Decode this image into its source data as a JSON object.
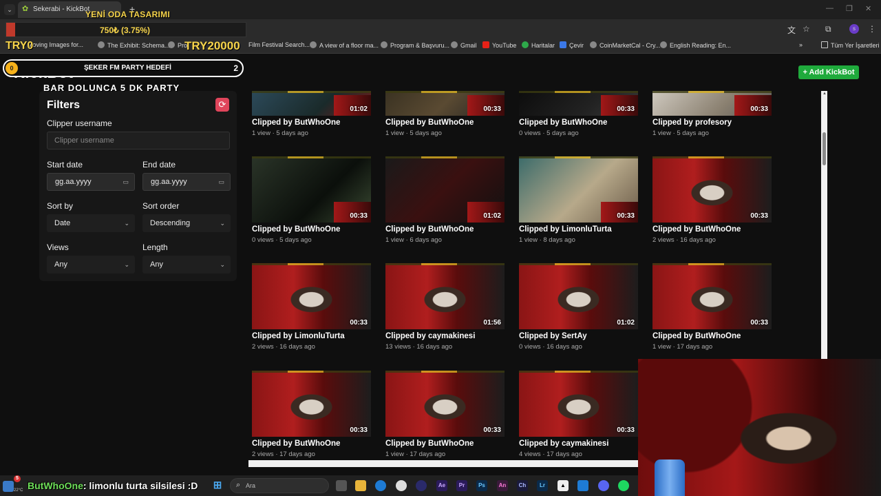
{
  "browser": {
    "tab_title": "Sekerabi - KickBot",
    "tab_new": "+",
    "tab_arrow": "⌄",
    "window_controls": [
      "—",
      "❐",
      "✕"
    ],
    "toolbar_icons": [
      "translate-icon",
      "star-icon",
      "extensions-icon",
      "profile-icon",
      "menu-icon"
    ],
    "profile_letter": "s",
    "bookmarks": [
      "Moving Images for...",
      "The Exhibit: Schema...",
      "Pro",
      "Film Festival Search...",
      "A view of a floor ma...",
      "Program & Başvuru...",
      "Gmail",
      "YouTube",
      "Haritalar",
      "Çevir",
      "CoinMarketCal - Cry...",
      "English Reading: En..."
    ],
    "bookmarks_more": "»",
    "bookmarks_all": "Tüm Yer İşaretleri"
  },
  "overlay": {
    "title": "YENİ ODA TASARIMI",
    "progress_text": "750₺ (3.75%)",
    "progress_percent": 3.75,
    "goal_min": "TRY0",
    "goal_max": "TRY20000",
    "party_label": "ŞEKER FM PARTY HEDEFİ",
    "party_count": "2",
    "coin": "0",
    "bar_text": "BAR DOLUNCA 5 DK PARTY",
    "chat_user": "ButWhoOne",
    "chat_text": ": limonlu turta silsilesi :D",
    "accent": "#f6d44b"
  },
  "app": {
    "logo": "KickBot",
    "add_button": "+ Add KickBot",
    "accent": "#1faa3c"
  },
  "filters": {
    "title": "Filters",
    "reset_icon": "refresh-icon",
    "clipper_label": "Clipper username",
    "clipper_placeholder": "Clipper username",
    "start_label": "Start date",
    "start_value": "gg.aa.yyyy",
    "end_label": "End date",
    "end_value": "gg.aa.yyyy",
    "sort_by_label": "Sort by",
    "sort_by_value": "Date",
    "sort_order_label": "Sort order",
    "sort_order_value": "Descending",
    "views_label": "Views",
    "views_value": "Any",
    "length_label": "Length",
    "length_value": "Any"
  },
  "clips": [
    {
      "by": "Clipped by ButWhoOne",
      "meta": "1 view · 5 days ago",
      "duration": "01:02",
      "thumb": "game1"
    },
    {
      "by": "Clipped by ButWhoOne",
      "meta": "1 view · 5 days ago",
      "duration": "00:33",
      "thumb": "game2"
    },
    {
      "by": "Clipped by ButWhoOne",
      "meta": "0 views · 5 days ago",
      "duration": "00:33",
      "thumb": "game3"
    },
    {
      "by": "Clipped by profesory",
      "meta": "1 view · 5 days ago",
      "duration": "00:33",
      "thumb": "game4"
    },
    {
      "by": "Clipped by ButWhoOne",
      "meta": "0 views · 5 days ago",
      "duration": "00:33",
      "thumb": "dark1"
    },
    {
      "by": "Clipped by ButWhoOne",
      "meta": "1 view · 6 days ago",
      "duration": "01:02",
      "thumb": "dark2"
    },
    {
      "by": "Clipped by LimonluTurta",
      "meta": "1 view · 8 days ago",
      "duration": "00:33",
      "thumb": "room"
    },
    {
      "by": "Clipped by ButWhoOne",
      "meta": "2 views · 16 days ago",
      "duration": "00:33",
      "thumb": "redroom"
    },
    {
      "by": "Clipped by LimonluTurta",
      "meta": "2 views · 16 days ago",
      "duration": "00:33",
      "thumb": "redroom"
    },
    {
      "by": "Clipped by caymakinesi",
      "meta": "13 views · 16 days ago",
      "duration": "01:56",
      "thumb": "redroom"
    },
    {
      "by": "Clipped by SertAy",
      "meta": "0 views · 16 days ago",
      "duration": "01:02",
      "thumb": "redroom"
    },
    {
      "by": "Clipped by ButWhoOne",
      "meta": "1 view · 17 days ago",
      "duration": "00:33",
      "thumb": "redroom"
    },
    {
      "by": "Clipped by ButWhoOne",
      "meta": "2 views · 17 days ago",
      "duration": "00:33",
      "thumb": "redroom"
    },
    {
      "by": "Clipped by ButWhoOne",
      "meta": "1 view · 17 days ago",
      "duration": "00:33",
      "thumb": "redroom"
    },
    {
      "by": "Clipped by caymakinesi",
      "meta": "4 views · 17 days ago",
      "duration": "00:33",
      "thumb": "redroom"
    }
  ],
  "taskbar": {
    "search_placeholder": "Ara",
    "temperature": "22°C",
    "notification_count": "5",
    "app_labels": [
      "Ae",
      "Pr",
      "Ps",
      "An",
      "Ch",
      "Lr"
    ]
  }
}
